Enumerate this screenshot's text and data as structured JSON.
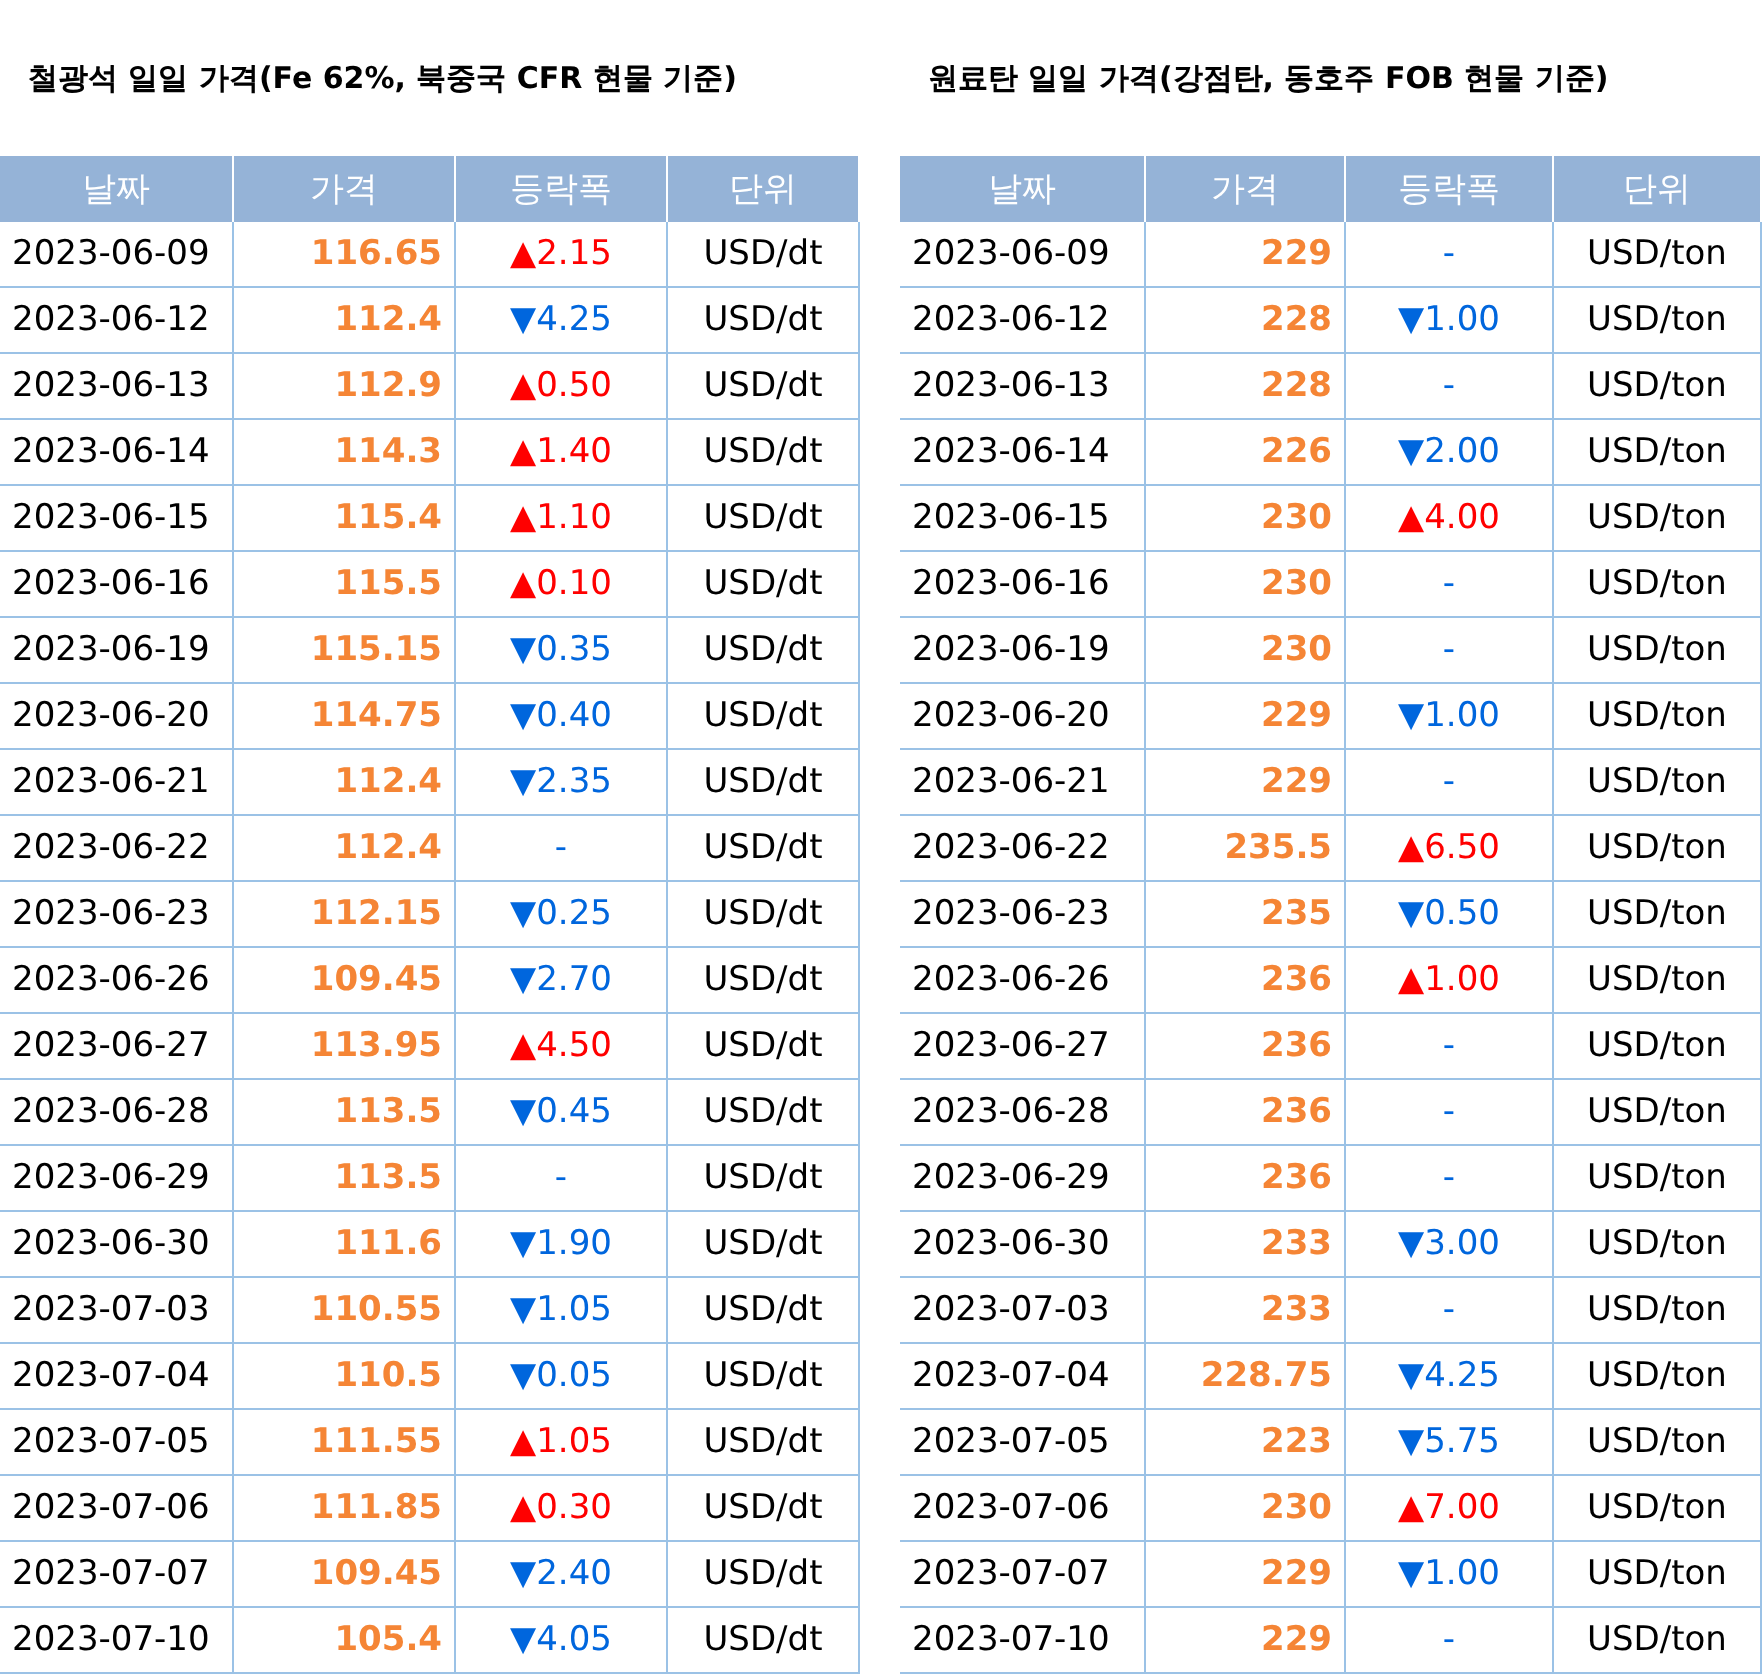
{
  "tables": [
    {
      "title": "철광석 일일 가격(Fe 62%, 북중국 CFR 현물 기준)",
      "columns": [
        "날짜",
        "가격",
        "등락폭",
        "단위"
      ],
      "rows": [
        {
          "date": "2023-06-09",
          "price": "116.65",
          "change": "▲2.15",
          "color": "#ff0000",
          "unit": "USD/dt"
        },
        {
          "date": "2023-06-12",
          "price": "112.4",
          "change": "▼4.25",
          "color": "#0066dd",
          "unit": "USD/dt"
        },
        {
          "date": "2023-06-13",
          "price": "112.9",
          "change": "▲0.50",
          "color": "#ff0000",
          "unit": "USD/dt"
        },
        {
          "date": "2023-06-14",
          "price": "114.3",
          "change": "▲1.40",
          "color": "#ff0000",
          "unit": "USD/dt"
        },
        {
          "date": "2023-06-15",
          "price": "115.4",
          "change": "▲1.10",
          "color": "#ff0000",
          "unit": "USD/dt"
        },
        {
          "date": "2023-06-16",
          "price": "115.5",
          "change": "▲0.10",
          "color": "#ff0000",
          "unit": "USD/dt"
        },
        {
          "date": "2023-06-19",
          "price": "115.15",
          "change": "▼0.35",
          "color": "#0066dd",
          "unit": "USD/dt"
        },
        {
          "date": "2023-06-20",
          "price": "114.75",
          "change": "▼0.40",
          "color": "#0066dd",
          "unit": "USD/dt"
        },
        {
          "date": "2023-06-21",
          "price": "112.4",
          "change": "▼2.35",
          "color": "#0066dd",
          "unit": "USD/dt"
        },
        {
          "date": "2023-06-22",
          "price": "112.4",
          "change": "-",
          "color": "#0066dd",
          "unit": "USD/dt"
        },
        {
          "date": "2023-06-23",
          "price": "112.15",
          "change": "▼0.25",
          "color": "#0066dd",
          "unit": "USD/dt"
        },
        {
          "date": "2023-06-26",
          "price": "109.45",
          "change": "▼2.70",
          "color": "#0066dd",
          "unit": "USD/dt"
        },
        {
          "date": "2023-06-27",
          "price": "113.95",
          "change": "▲4.50",
          "color": "#ff0000",
          "unit": "USD/dt"
        },
        {
          "date": "2023-06-28",
          "price": "113.5",
          "change": "▼0.45",
          "color": "#0066dd",
          "unit": "USD/dt"
        },
        {
          "date": "2023-06-29",
          "price": "113.5",
          "change": "-",
          "color": "#0066dd",
          "unit": "USD/dt"
        },
        {
          "date": "2023-06-30",
          "price": "111.6",
          "change": "▼1.90",
          "color": "#0066dd",
          "unit": "USD/dt"
        },
        {
          "date": "2023-07-03",
          "price": "110.55",
          "change": "▼1.05",
          "color": "#0066dd",
          "unit": "USD/dt"
        },
        {
          "date": "2023-07-04",
          "price": "110.5",
          "change": "▼0.05",
          "color": "#0066dd",
          "unit": "USD/dt"
        },
        {
          "date": "2023-07-05",
          "price": "111.55",
          "change": "▲1.05",
          "color": "#ff0000",
          "unit": "USD/dt"
        },
        {
          "date": "2023-07-06",
          "price": "111.85",
          "change": "▲0.30",
          "color": "#ff0000",
          "unit": "USD/dt"
        },
        {
          "date": "2023-07-07",
          "price": "109.45",
          "change": "▼2.40",
          "color": "#0066dd",
          "unit": "USD/dt"
        },
        {
          "date": "2023-07-10",
          "price": "105.4",
          "change": "▼4.05",
          "color": "#0066dd",
          "unit": "USD/dt"
        }
      ]
    },
    {
      "title": "원료탄 일일 가격(강점탄, 동호주 FOB 현물 기준)",
      "columns": [
        "날짜",
        "가격",
        "등락폭",
        "단위"
      ],
      "rows": [
        {
          "date": "2023-06-09",
          "price": "229",
          "change": "-",
          "color": "#0066dd",
          "unit": "USD/ton"
        },
        {
          "date": "2023-06-12",
          "price": "228",
          "change": "▼1.00",
          "color": "#0066dd",
          "unit": "USD/ton"
        },
        {
          "date": "2023-06-13",
          "price": "228",
          "change": "-",
          "color": "#0066dd",
          "unit": "USD/ton"
        },
        {
          "date": "2023-06-14",
          "price": "226",
          "change": "▼2.00",
          "color": "#0066dd",
          "unit": "USD/ton"
        },
        {
          "date": "2023-06-15",
          "price": "230",
          "change": "▲4.00",
          "color": "#ff0000",
          "unit": "USD/ton"
        },
        {
          "date": "2023-06-16",
          "price": "230",
          "change": "-",
          "color": "#0066dd",
          "unit": "USD/ton"
        },
        {
          "date": "2023-06-19",
          "price": "230",
          "change": "-",
          "color": "#0066dd",
          "unit": "USD/ton"
        },
        {
          "date": "2023-06-20",
          "price": "229",
          "change": "▼1.00",
          "color": "#0066dd",
          "unit": "USD/ton"
        },
        {
          "date": "2023-06-21",
          "price": "229",
          "change": "-",
          "color": "#0066dd",
          "unit": "USD/ton"
        },
        {
          "date": "2023-06-22",
          "price": "235.5",
          "change": "▲6.50",
          "color": "#ff0000",
          "unit": "USD/ton"
        },
        {
          "date": "2023-06-23",
          "price": "235",
          "change": "▼0.50",
          "color": "#0066dd",
          "unit": "USD/ton"
        },
        {
          "date": "2023-06-26",
          "price": "236",
          "change": "▲1.00",
          "color": "#ff0000",
          "unit": "USD/ton"
        },
        {
          "date": "2023-06-27",
          "price": "236",
          "change": "-",
          "color": "#0066dd",
          "unit": "USD/ton"
        },
        {
          "date": "2023-06-28",
          "price": "236",
          "change": "-",
          "color": "#0066dd",
          "unit": "USD/ton"
        },
        {
          "date": "2023-06-29",
          "price": "236",
          "change": "-",
          "color": "#0066dd",
          "unit": "USD/ton"
        },
        {
          "date": "2023-06-30",
          "price": "233",
          "change": "▼3.00",
          "color": "#0066dd",
          "unit": "USD/ton"
        },
        {
          "date": "2023-07-03",
          "price": "233",
          "change": "-",
          "color": "#0066dd",
          "unit": "USD/ton"
        },
        {
          "date": "2023-07-04",
          "price": "228.75",
          "change": "▼4.25",
          "color": "#0066dd",
          "unit": "USD/ton"
        },
        {
          "date": "2023-07-05",
          "price": "223",
          "change": "▼5.75",
          "color": "#0066dd",
          "unit": "USD/ton"
        },
        {
          "date": "2023-07-06",
          "price": "230",
          "change": "▲7.00",
          "color": "#ff0000",
          "unit": "USD/ton"
        },
        {
          "date": "2023-07-07",
          "price": "229",
          "change": "▼1.00",
          "color": "#0066dd",
          "unit": "USD/ton"
        },
        {
          "date": "2023-07-10",
          "price": "229",
          "change": "-",
          "color": "#0066dd",
          "unit": "USD/ton"
        }
      ]
    }
  ]
}
